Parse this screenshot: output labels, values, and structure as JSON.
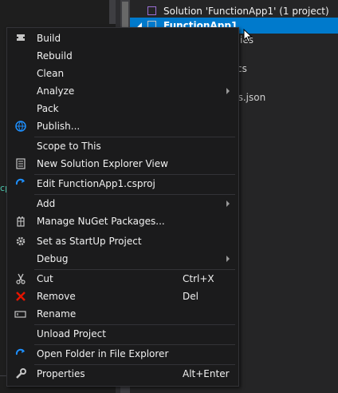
{
  "solution_explorer": {
    "solution_label": "Solution 'FunctionApp1' (1 project)",
    "project_label": "FunctionApp1",
    "partial_rows": [
      "ies",
      "cs",
      "gs.json"
    ],
    "left_edge_text": "cp"
  },
  "menu": {
    "build": "Build",
    "rebuild": "Rebuild",
    "clean": "Clean",
    "analyze": "Analyze",
    "pack": "Pack",
    "publish": "Publish...",
    "scope_to_this": "Scope to This",
    "new_solution_explorer_view": "New Solution Explorer View",
    "edit_project": "Edit FunctionApp1.csproj",
    "add": "Add",
    "manage_nuget": "Manage NuGet Packages...",
    "set_startup": "Set as StartUp Project",
    "debug": "Debug",
    "cut": "Cut",
    "cut_shortcut": "Ctrl+X",
    "remove": "Remove",
    "remove_shortcut": "Del",
    "rename": "Rename",
    "unload_project": "Unload Project",
    "open_folder": "Open Folder in File Explorer",
    "properties": "Properties",
    "properties_shortcut": "Alt+Enter"
  },
  "icons": {
    "build": "build-icon",
    "publish": "globe-icon",
    "new_view": "new-view-icon",
    "edit": "refresh-icon",
    "nuget": "nuget-icon",
    "startup": "gear-icon",
    "cut": "scissors-icon",
    "remove": "red-x-icon",
    "rename": "rename-icon",
    "open_folder": "refresh-icon",
    "properties": "wrench-icon"
  },
  "colors": {
    "menu_bg": "#1b1b1c",
    "selection": "#007acc",
    "remove_icon": "#e51400",
    "accent_blue": "#1e90ff"
  }
}
